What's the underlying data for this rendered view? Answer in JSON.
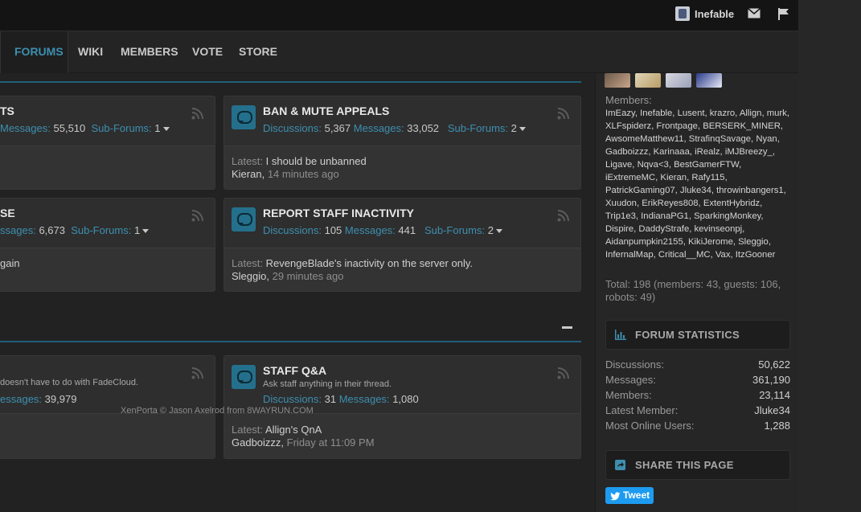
{
  "topbar": {
    "username": "Inefable",
    "mail_icon": "envelope-icon",
    "flag_icon": "flag-icon"
  },
  "nav": {
    "tabs": [
      {
        "label": "FORUMS",
        "active": true
      },
      {
        "label": "WIKI",
        "active": false
      },
      {
        "label": "MEMBERS",
        "active": false
      },
      {
        "label": "VOTE",
        "active": false
      },
      {
        "label": "STORE",
        "active": false
      }
    ]
  },
  "left_partial": {
    "row1_title": "TS",
    "row1_messages_label": "Messages:",
    "row1_messages_value": "55,510",
    "row1_subforums_label": "Sub-Forums:",
    "row1_subforums_value": "1",
    "row2_title": "SE",
    "row2_messages_label": "ssages:",
    "row2_messages_value": "6,673",
    "row2_subforums_label": "Sub-Forums:",
    "row2_subforums_value": "1",
    "row2_latest": "gain",
    "row3_desc": "doesn't have to do with FadeCloud.",
    "row3_messages_label": "essages:",
    "row3_messages_value": "39,979"
  },
  "forums": [
    {
      "title": "BAN & MUTE APPEALS",
      "description": "",
      "discussions_label": "Discussions:",
      "discussions": "5,367",
      "messages_label": "Messages:",
      "messages": "33,052",
      "subforums_label": "Sub-Forums:",
      "subforums": "2",
      "latest_label": "Latest:",
      "latest_title": "I should be unbanned",
      "latest_user": "Kieran",
      "latest_time": "14 minutes ago"
    },
    {
      "title": "REPORT STAFF INACTIVITY",
      "description": "",
      "discussions_label": "Discussions:",
      "discussions": "105",
      "messages_label": "Messages:",
      "messages": "441",
      "subforums_label": "Sub-Forums:",
      "subforums": "2",
      "latest_label": "Latest:",
      "latest_title": "RevengeBlade's inactivity on the server only.",
      "latest_user": "Sleggio",
      "latest_time": "29 minutes ago"
    },
    {
      "title": "STAFF Q&A",
      "description": "Ask staff anything in their thread.",
      "discussions_label": "Discussions:",
      "discussions": "31",
      "messages_label": "Messages:",
      "messages": "1,080",
      "subforums_label": "",
      "subforums": "",
      "latest_label": "Latest:",
      "latest_title": "Allign's QnA",
      "latest_user": "Gadboizzz",
      "latest_time": "Friday at 11:09 PM"
    }
  ],
  "footer": {
    "credit": "XenPorta © Jason Axelrod from 8WAYRUN.COM"
  },
  "sidebar": {
    "members_label": "Members:",
    "members_list": "ImEazy, Inefable, Lusent, krazro, Allign, murk, XLFspiderz, Frontpage, BERSERK_MINER, AwsomeMatthew11, StrafinqSavage, Nyan, Gadboizzz, Karinaaa, iRealz, iMJBreezy_, Ligave, Nqva<3, BestGamerFTW, iExtremeMC, Kieran, Rafy115, PatrickGaming07, Jluke34, throwinbangers1, Xuudon, ErikReyes808, ExtentHybridz, Trip1e3, IndianaPG1, SparkingMonkey, Dispire, DaddyStrafe, kevinseonpj, Aidanpumpkin2155, KikiJerome, Sleggio, InfernalMap, Critical__MC, Vax, ItzGooner",
    "total": "Total: 198 (members: 43, guests: 106, robots: 49)",
    "stats_title": "FORUM STATISTICS",
    "stats": [
      {
        "label": "Discussions:",
        "value": "50,622"
      },
      {
        "label": "Messages:",
        "value": "361,190"
      },
      {
        "label": "Members:",
        "value": "23,114"
      },
      {
        "label": "Latest Member:",
        "value": "Jluke34"
      },
      {
        "label": "Most Online Users:",
        "value": "1,288"
      }
    ],
    "share_title": "SHARE THIS PAGE",
    "tweet_label": "Tweet"
  },
  "colors": {
    "accent": "#3d8fb0",
    "background": "#222222",
    "card": "#2e2e2e",
    "tweet": "#1d9bf0"
  }
}
